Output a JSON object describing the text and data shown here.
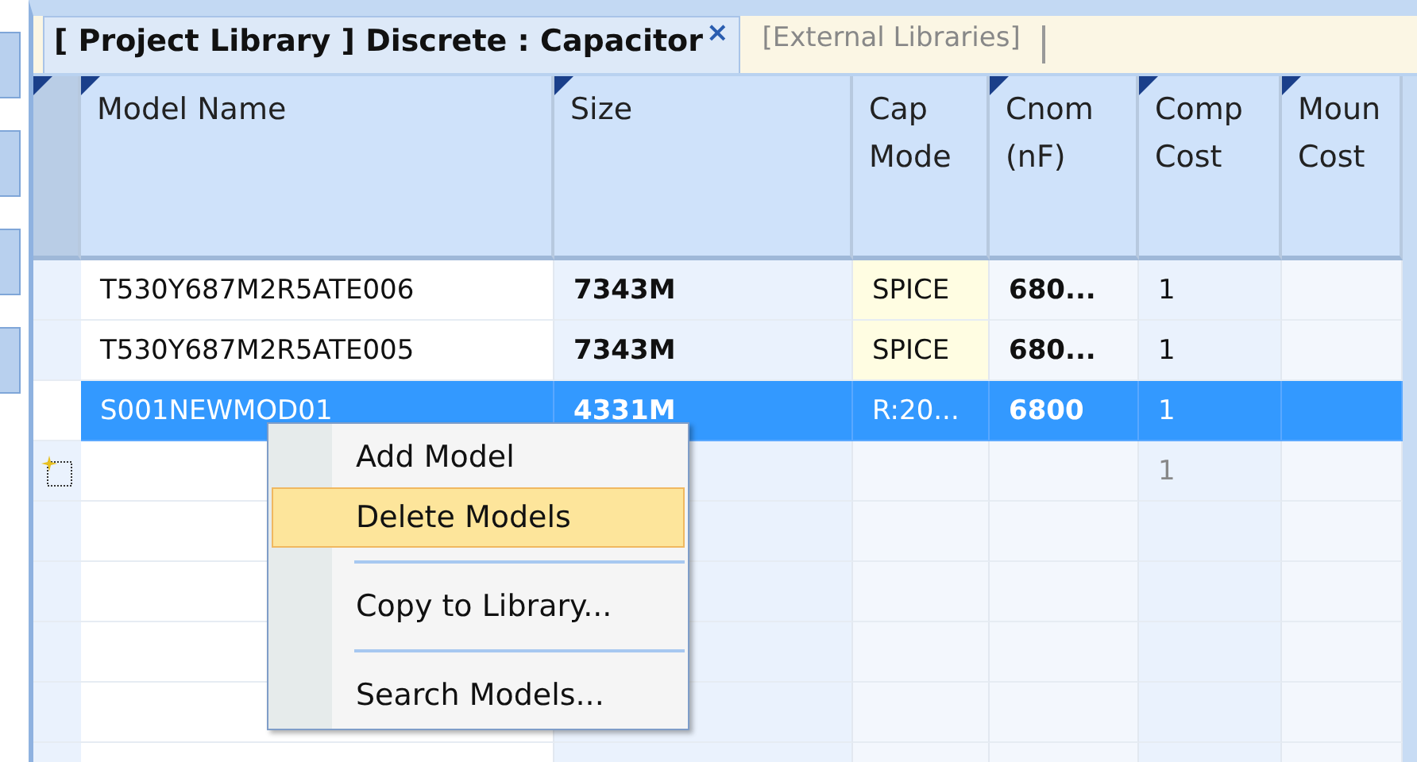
{
  "tabs": [
    {
      "label": "[ Project Library ] Discrete : Capacitor",
      "selected": true,
      "closable": true
    },
    {
      "label": "[External Libraries]",
      "selected": false,
      "closable": false
    }
  ],
  "close_glyph": "×",
  "table": {
    "columns": [
      {
        "label": "Model Name",
        "marker": true
      },
      {
        "label": "Size",
        "marker": true
      },
      {
        "label": "Cap Mode",
        "marker": false
      },
      {
        "label": "Cnom (nF)",
        "marker": true
      },
      {
        "label": "Comp Cost",
        "marker": true
      },
      {
        "label": "Moun Cost",
        "marker": true
      }
    ],
    "rows": [
      {
        "kind": "data",
        "selected": false,
        "cells": [
          "T530Y687M2R5ATE006",
          "7343M",
          "SPICE",
          "680...",
          "1",
          ""
        ]
      },
      {
        "kind": "data",
        "selected": false,
        "cells": [
          "T530Y687M2R5ATE005",
          "7343M",
          "SPICE",
          "680...",
          "1",
          ""
        ]
      },
      {
        "kind": "data",
        "selected": true,
        "cells": [
          "S001NEWMOD01",
          "4331M",
          "R:20...",
          "6800",
          "1",
          ""
        ]
      },
      {
        "kind": "new",
        "selected": false,
        "cells": [
          "",
          "",
          "",
          "",
          "1",
          ""
        ]
      }
    ]
  },
  "context_menu": {
    "items": [
      {
        "label": "Add Model",
        "highlighted": false,
        "separator_before": false
      },
      {
        "label": "Delete Models",
        "highlighted": true,
        "separator_before": false
      },
      {
        "label": "Copy to Library...",
        "highlighted": false,
        "separator_before": true
      },
      {
        "label": "Search Models...",
        "highlighted": false,
        "separator_before": true
      }
    ]
  }
}
